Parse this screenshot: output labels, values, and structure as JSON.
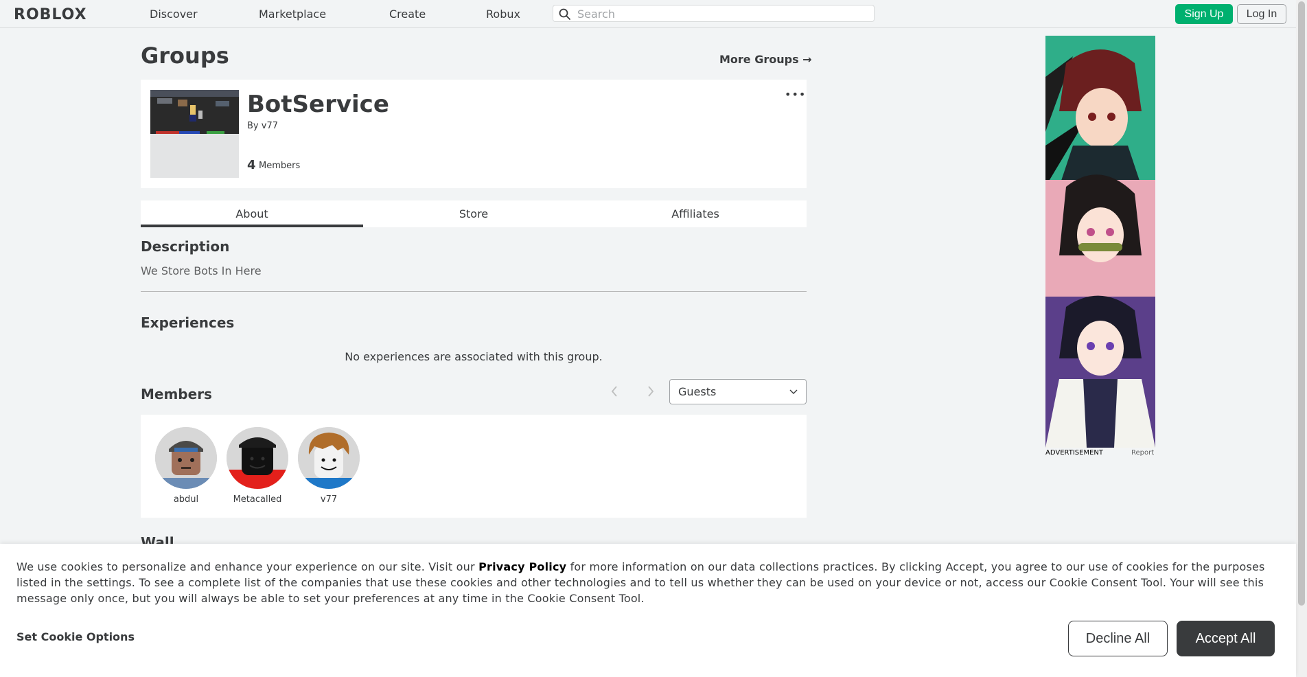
{
  "nav": {
    "logo": "ROBLOX",
    "links": [
      "Discover",
      "Marketplace",
      "Create",
      "Robux"
    ],
    "search_placeholder": "Search",
    "signup_label": "Sign Up",
    "login_label": "Log In"
  },
  "page": {
    "title": "Groups",
    "more_groups": "More Groups →"
  },
  "group": {
    "name": "BotService",
    "owner": "By v77",
    "member_count": "4",
    "member_label": "Members",
    "more_menu": "•••"
  },
  "tabs": [
    "About",
    "Store",
    "Affiliates"
  ],
  "about": {
    "description_title": "Description",
    "description_text": "We Store Bots In Here",
    "experiences_title": "Experiences",
    "experiences_empty": "No experiences are associated with this group.",
    "members_title": "Members",
    "role_filter": "Guests",
    "members": [
      {
        "name": "abdul"
      },
      {
        "name": "Metacalled"
      },
      {
        "name": "v77"
      }
    ],
    "wall_title": "Wall"
  },
  "ad": {
    "label": "ADVERTISEMENT",
    "report": "Report"
  },
  "cookie": {
    "text_before": "We use cookies to personalize and enhance your experience on our site. Visit our ",
    "privacy_link": "Privacy Policy",
    "text_after": " for more information on our data collections practices. By clicking Accept, you agree to our use of cookies for the purposes listed in the settings. To see a complete list of the companies that use these cookies and other technologies and to tell us whether they can be used on your device or not, access our Cookie Consent Tool. Your will see this message only once, but you will always be able to set your preferences at any time in the Cookie Consent Tool.",
    "options_label": "Set Cookie Options",
    "decline_label": "Decline All",
    "accept_label": "Accept All"
  },
  "colors": {
    "primary_green": "#00b06f",
    "text_dark": "#393b3d",
    "background": "#f2f4f5"
  }
}
